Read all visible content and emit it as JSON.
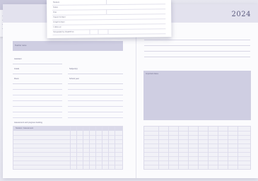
{
  "planner": {
    "year": "2024",
    "left_page": {
      "title_bar_label": "Teacher name",
      "fields": [
        "Assistant",
        "Grade",
        "Subject(s)",
        "Room",
        "School year",
        "Phone"
      ],
      "grid_caption": "Assessment and progress tracking",
      "grid_header": "Student / Assessment"
    },
    "right_page": {
      "block_label": "Important dates"
    }
  },
  "card": {
    "rows": [
      "Student",
      "Notes",
      "Due",
      "Parent Contact",
      "Email Contact",
      "Follow-up",
      "Scheduled by Chatterbox"
    ]
  },
  "colors": {
    "lilac": "#cfcee2",
    "header": "#e3e2ee",
    "year_text": "#5d5c80"
  }
}
